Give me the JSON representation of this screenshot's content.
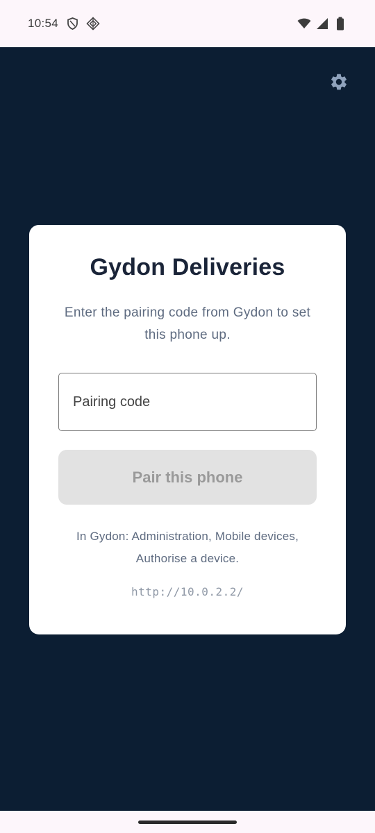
{
  "status_bar": {
    "time": "10:54",
    "icons_left": [
      "shield-icon",
      "vpn-key-icon"
    ],
    "icons_right": [
      "wifi-icon",
      "cellular-signal-icon",
      "battery-icon"
    ]
  },
  "header": {
    "settings_icon": "gear-icon"
  },
  "card": {
    "title": "Gydon Deliveries",
    "subtitle": "Enter the pairing code from Gydon to set this phone up.",
    "input_placeholder": "Pairing code",
    "input_value": "",
    "button_label": "Pair this phone",
    "help_text": "In Gydon: Administration, Mobile devices, Authorise a device.",
    "server_url": "http://10.0.2.2/"
  },
  "colors": {
    "background": "#0c1e33",
    "card": "#ffffff",
    "title": "#1a2438",
    "muted_text": "#5e6b80",
    "button_disabled_bg": "#e2e2e2",
    "button_disabled_text": "#9a9a9a",
    "gear": "#8fa2bc"
  }
}
